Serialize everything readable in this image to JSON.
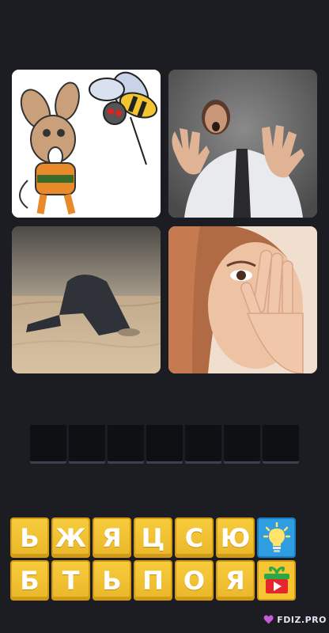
{
  "puzzle": {
    "pictures": [
      {
        "name": "cartoon-mouse-and-bee",
        "alt": "cartoon mouse and bee"
      },
      {
        "name": "frightened-man",
        "alt": "frightened man"
      },
      {
        "name": "man-head-in-sand",
        "alt": "man with head in sand"
      },
      {
        "name": "woman-covering-face",
        "alt": "woman covering face"
      }
    ],
    "answer_slot_count": 7
  },
  "letters": {
    "row1": [
      "Ь",
      "Ж",
      "Я",
      "Ц",
      "С",
      "Ю"
    ],
    "row2": [
      "Б",
      "Т",
      "Ь",
      "П",
      "О",
      "Я"
    ]
  },
  "helpers": {
    "hint_icon": "lightbulb-icon",
    "gift_icon": "gift-video-icon"
  },
  "watermark": {
    "text": "FDIZ.PRO",
    "colors": {
      "heart": "#c65bd6"
    }
  }
}
